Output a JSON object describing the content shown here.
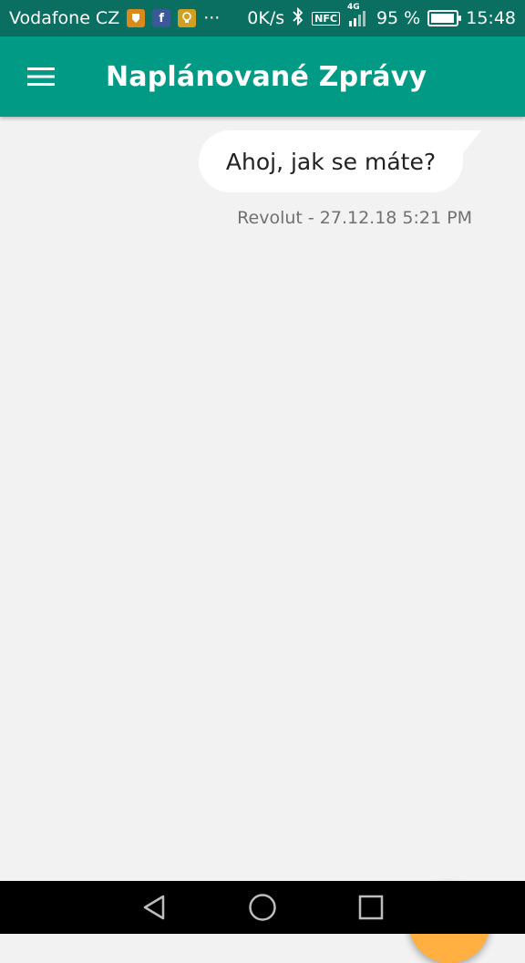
{
  "status_bar": {
    "carrier": "Vodafone CZ",
    "overflow": "···",
    "speed": "0K/s",
    "nfc": "NFC",
    "network": "4G",
    "battery_percent": "95 %",
    "battery_level": 0.95,
    "time": "15:48",
    "notification_icons": [
      "badge-icon",
      "facebook-icon",
      "lightbulb-icon"
    ]
  },
  "app_bar": {
    "title": "Naplánované Zprávy",
    "menu_icon": "hamburger-menu-icon",
    "color": "#009a85"
  },
  "messages": [
    {
      "text": "Ahoj, jak se máte?",
      "meta": "Revolut - 27.12.18 5:21 PM"
    }
  ],
  "fab": {
    "label": "+",
    "color": "#ffb040"
  },
  "nav_bar": {
    "buttons": [
      "back-icon",
      "home-icon",
      "recents-icon"
    ]
  }
}
